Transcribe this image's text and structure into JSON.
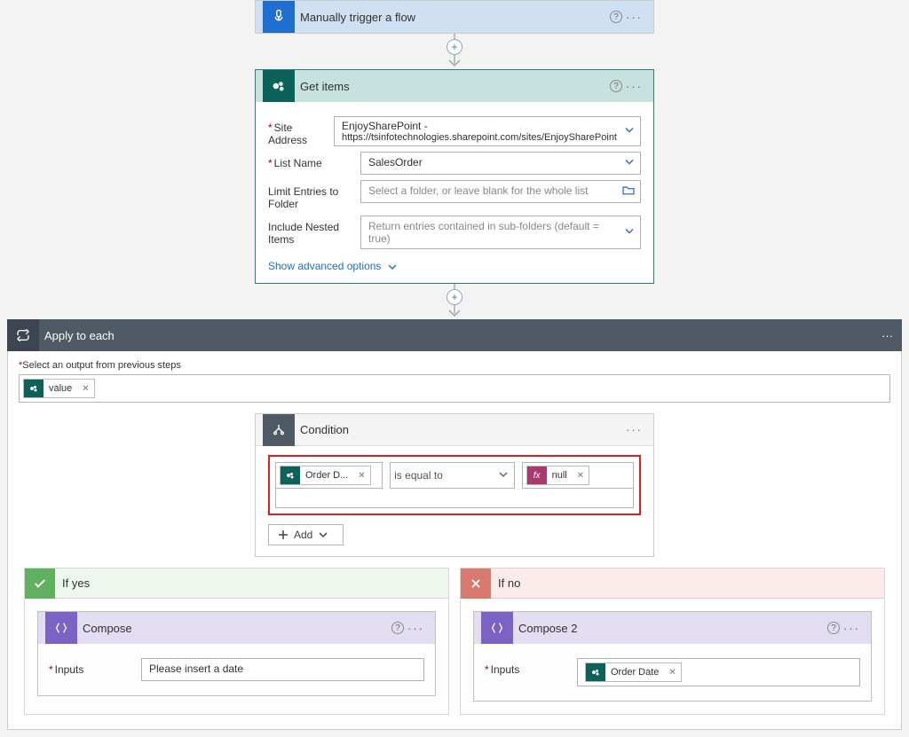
{
  "trigger": {
    "title": "Manually trigger a flow"
  },
  "getitems": {
    "title": "Get items",
    "labels": {
      "site_address": "Site Address",
      "list_name": "List Name",
      "limit": "Limit Entries to Folder",
      "nested": "Include Nested Items"
    },
    "values": {
      "site_address_line1": "EnjoySharePoint -",
      "site_address_line2": "https://tsinfotechnologies.sharepoint.com/sites/EnjoySharePoint",
      "list_name": "SalesOrder",
      "limit_placeholder": "Select a folder, or leave blank for the whole list",
      "nested_placeholder": "Return entries contained in sub-folders (default = true)"
    },
    "show_adv": "Show advanced options"
  },
  "apply": {
    "title": "Apply to each",
    "select_label": "Select an output from previous steps",
    "token_value": "value"
  },
  "condition": {
    "title": "Condition",
    "left_token": "Order D...",
    "operator": "is equal to",
    "right_token": "null",
    "add_label": "Add"
  },
  "branches": {
    "yes_label": "If yes",
    "no_label": "If no"
  },
  "compose_yes": {
    "title": "Compose",
    "input_label": "Inputs",
    "value": "Please insert a date"
  },
  "compose_no": {
    "title": "Compose 2",
    "input_label": "Inputs",
    "token": "Order Date"
  }
}
